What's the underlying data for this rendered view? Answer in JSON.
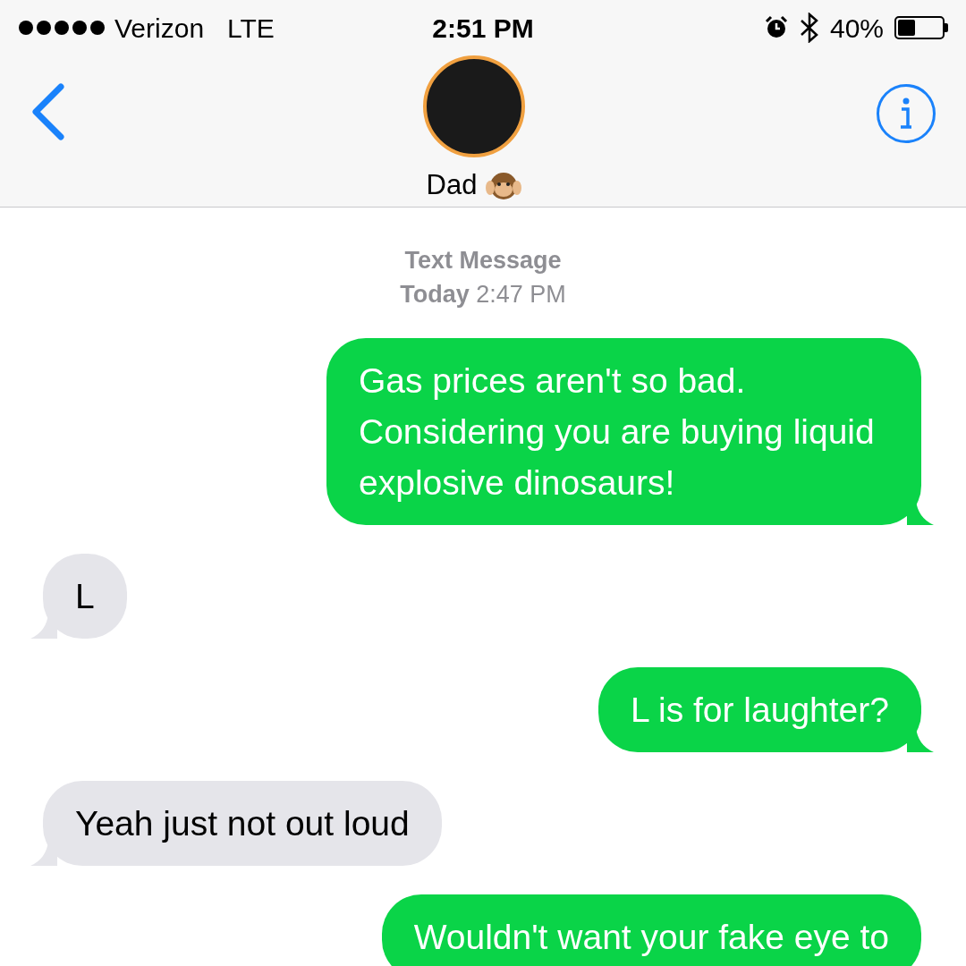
{
  "status_bar": {
    "carrier": "Verizon",
    "network": "LTE",
    "time": "2:51 PM",
    "battery": "40%"
  },
  "contact": {
    "name": "Dad"
  },
  "thread": {
    "service": "Text Message",
    "timestamp": "**Today** 2:47 PM"
  },
  "messages": [
    {
      "kind": "sent",
      "text": "Gas prices aren't so bad. Considering you are buying liquid explosive dinosaurs!"
    },
    {
      "kind": "received",
      "text": "L"
    },
    {
      "kind": "sent",
      "text": "L is for laughter?"
    },
    {
      "kind": "received",
      "text": "Yeah just not out loud"
    },
    {
      "kind": "sent",
      "text": "Wouldn't want your fake eye to"
    }
  ]
}
